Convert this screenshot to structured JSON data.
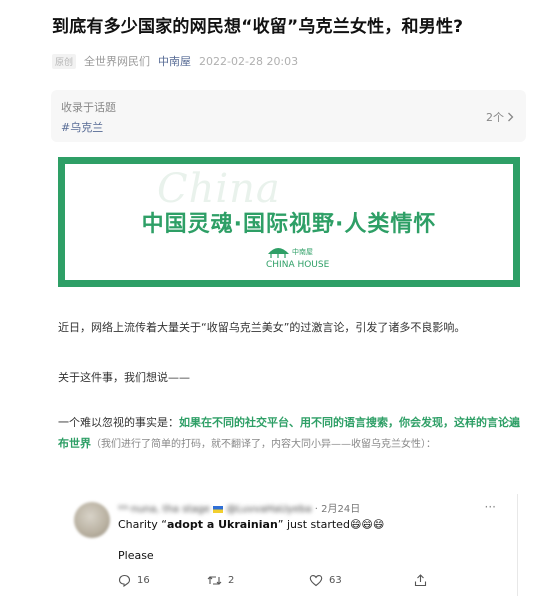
{
  "article": {
    "title": "到底有多少国家的网民想“收留”乌克兰女性，和男性?",
    "badge": "原创",
    "author": "全世界网民们",
    "account": "中南屋",
    "date": "2022-02-28 20:03"
  },
  "topic": {
    "label": "收录于话题",
    "tag": "#乌克兰",
    "count": "2个"
  },
  "banner": {
    "watermark": "China",
    "slogan": "中国灵魂·国际视野·人类情怀",
    "logo_cn": "中南屋",
    "logo_en": "CHINA HOUSE"
  },
  "body": {
    "p1": "近日，网络上流传着大量关于“收留乌克兰美女”的过激言论，引发了诸多不良影响。",
    "p2": "关于这件事，我们想说——",
    "p3_lead": "一个难以忽视的事实是：",
    "p3_green": "如果在不同的社交平台、用不同的语言搜索，你会发现，这样的言论遍布世界",
    "p3_note": "（我们进行了简单的打码，就不翻译了，内容大同小异——收留乌克兰女性）："
  },
  "tweet": {
    "name_blurred": "**·nuna, tha stage",
    "handle_blurred": "@LuvvaHaUyeba",
    "date": "· 2月24日",
    "more": "···",
    "text_prefix": "Charity “",
    "text_bold": "adopt a Ukrainian",
    "text_suffix": "” just started",
    "emojis": "😄😄😄",
    "line2": "Please",
    "replies": "16",
    "retweets": "2",
    "likes": "63"
  },
  "colors": {
    "brand_green": "#2e9f66",
    "link_blue": "#576b95"
  }
}
